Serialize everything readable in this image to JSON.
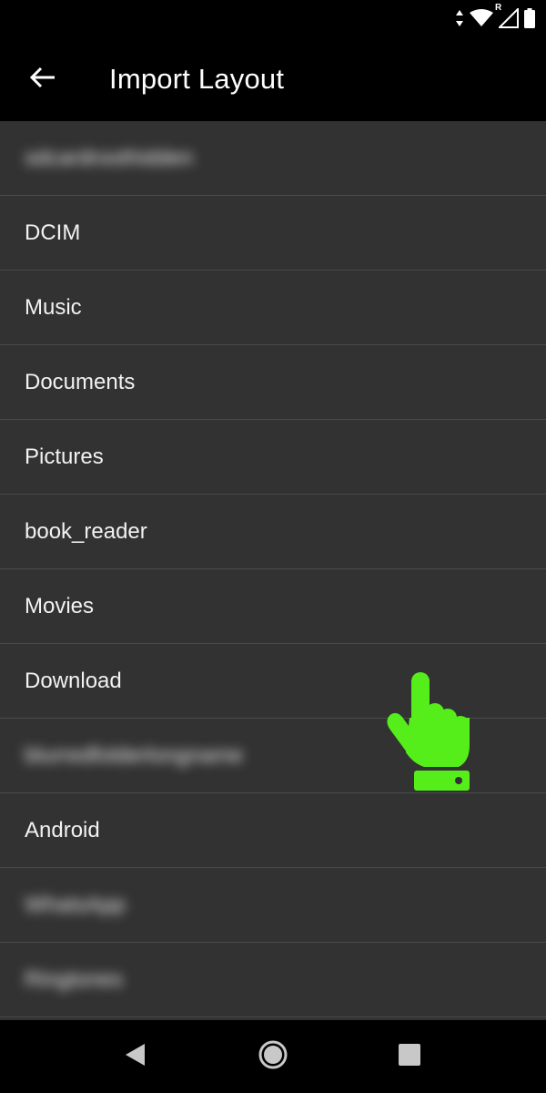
{
  "status_bar": {
    "icons": [
      "data-arrows-icon",
      "wifi-icon",
      "signal-roaming-icon",
      "battery-icon"
    ],
    "roaming_label": "R"
  },
  "app_bar": {
    "title": "Import Layout",
    "back_icon": "arrow-left-icon"
  },
  "list": {
    "items": [
      {
        "label": "sdcardroothidden",
        "blurred": true
      },
      {
        "label": "DCIM",
        "blurred": false
      },
      {
        "label": "Music",
        "blurred": false
      },
      {
        "label": "Documents",
        "blurred": false
      },
      {
        "label": "Pictures",
        "blurred": false
      },
      {
        "label": "book_reader",
        "blurred": false
      },
      {
        "label": "Movies",
        "blurred": false
      },
      {
        "label": "Download",
        "blurred": false
      },
      {
        "label": "blurredfolderlongname",
        "blurred": true
      },
      {
        "label": "Android",
        "blurred": false
      },
      {
        "label": "WhatsApp",
        "blurred": true
      },
      {
        "label": "Ringtones",
        "blurred": true
      }
    ]
  },
  "overlay": {
    "pointer_icon": "hand-pointer-icon",
    "pointer_color": "#55ee1a"
  },
  "nav_bar": {
    "icons": [
      "back-triangle-icon",
      "home-circle-icon",
      "recents-square-icon"
    ]
  },
  "colors": {
    "background": "#000000",
    "list_background": "#323232",
    "divider": "#4a4a4a",
    "text": "#ffffff"
  }
}
